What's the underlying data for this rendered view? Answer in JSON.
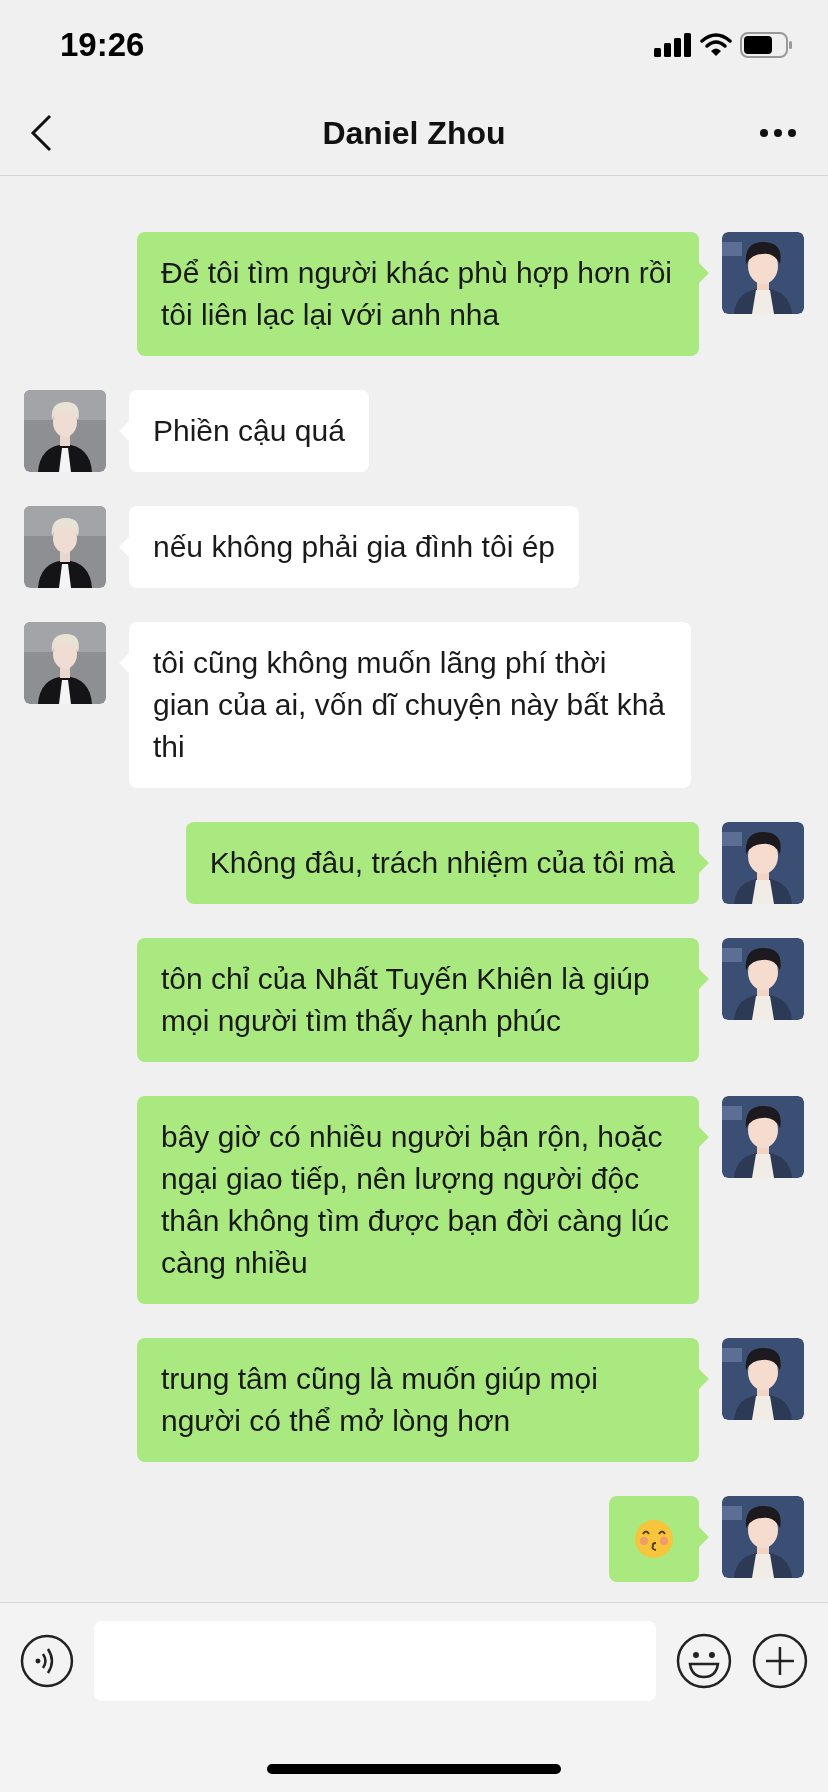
{
  "status_bar": {
    "time": "19:26"
  },
  "header": {
    "title": "Daniel Zhou"
  },
  "messages": [
    {
      "outgoing": true,
      "kind": "text",
      "text": "Để tôi tìm người khác phù hợp hơn rồi tôi liên lạc lại với anh nha"
    },
    {
      "outgoing": false,
      "kind": "text",
      "text": "Phiền cậu quá"
    },
    {
      "outgoing": false,
      "kind": "text",
      "text": "nếu không phải gia đình tôi ép"
    },
    {
      "outgoing": false,
      "kind": "text",
      "text": "tôi cũng không muốn lãng phí thời gian của ai, vốn dĩ chuyện này bất khả thi"
    },
    {
      "outgoing": true,
      "kind": "text",
      "text": "Không đâu, trách nhiệm của tôi mà"
    },
    {
      "outgoing": true,
      "kind": "text",
      "text": "tôn chỉ của Nhất Tuyến Khiên là giúp mọi người tìm thấy hạnh phúc"
    },
    {
      "outgoing": true,
      "kind": "text",
      "text": "bây giờ có nhiều người bận rộn, hoặc ngại giao tiếp, nên lượng người độc thân không tìm được bạn đời càng lúc càng nhiều"
    },
    {
      "outgoing": true,
      "kind": "text",
      "text": "trung tâm cũng là muốn giúp mọi người có thể mở lòng hơn"
    },
    {
      "outgoing": true,
      "kind": "emoji"
    }
  ]
}
